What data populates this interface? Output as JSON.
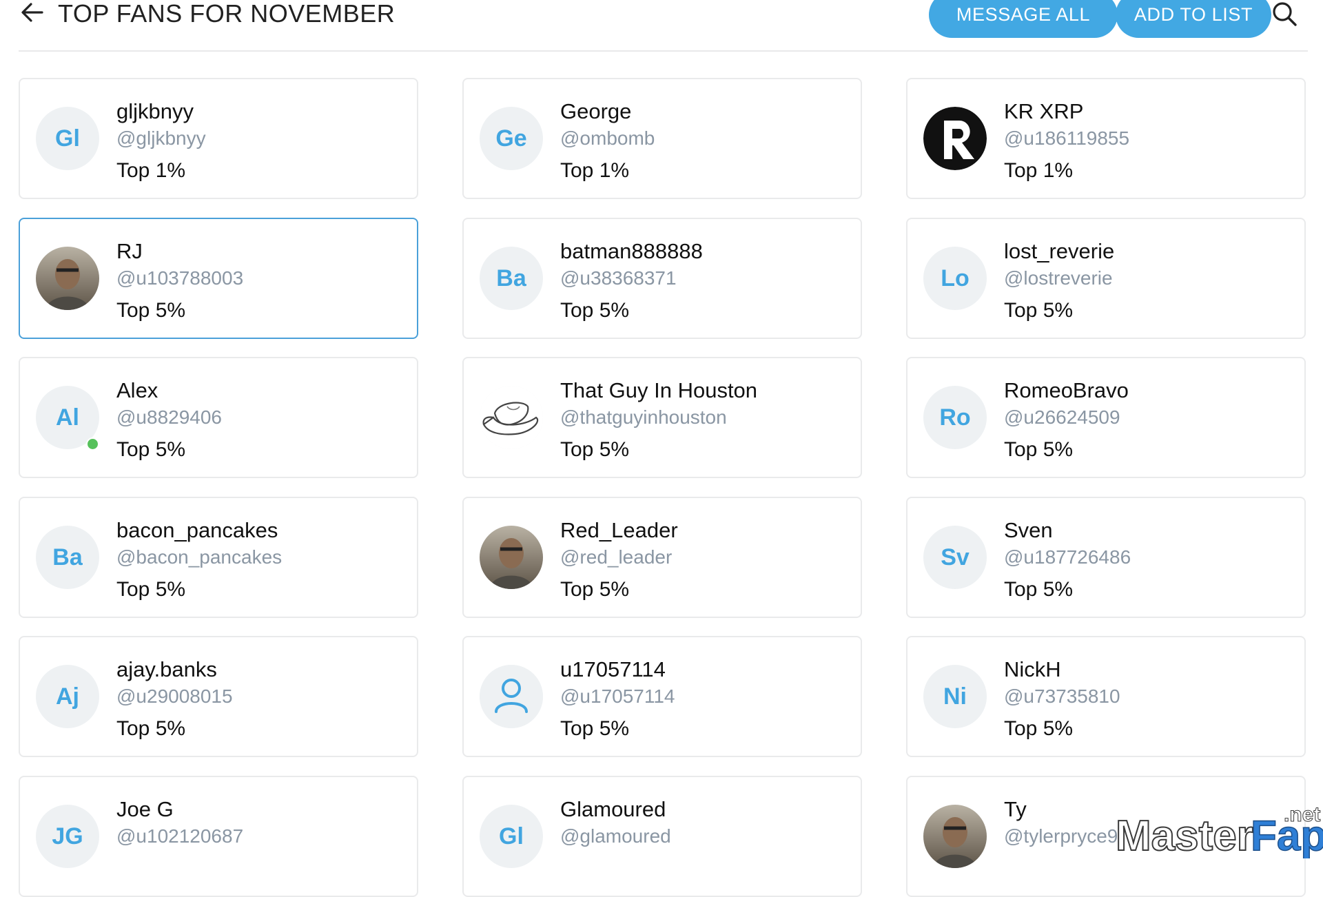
{
  "header": {
    "title": "TOP FANS FOR NOVEMBER",
    "message_all_label": "MESSAGE ALL",
    "add_to_list_label": "ADD TO LIST"
  },
  "colors": {
    "accent": "#42a8e3",
    "initials": "#41a5e0",
    "avatar_bg": "#eef1f3",
    "handle": "#8a96a3",
    "online": "#56c15b",
    "selected_border": "#4aa0d9"
  },
  "fans": [
    {
      "name": "gljkbnyy",
      "handle": "@gljkbnyy",
      "rank": "Top 1%",
      "initials": "Gl",
      "avatar": "initials"
    },
    {
      "name": "George",
      "handle": "@ombomb",
      "rank": "Top 1%",
      "initials": "Ge",
      "avatar": "initials"
    },
    {
      "name": "KR XRP",
      "handle": "@u186119855",
      "rank": "Top 1%",
      "initials": "",
      "avatar": "r-logo-icon"
    },
    {
      "name": "RJ",
      "handle": "@u103788003",
      "rank": "Top 5%",
      "initials": "",
      "avatar": "photo",
      "selected": true
    },
    {
      "name": "batman888888",
      "handle": "@u38368371",
      "rank": "Top 5%",
      "initials": "Ba",
      "avatar": "initials"
    },
    {
      "name": "lost_reverie",
      "handle": "@lostreverie",
      "rank": "Top 5%",
      "initials": "Lo",
      "avatar": "initials"
    },
    {
      "name": "Alex",
      "handle": "@u8829406",
      "rank": "Top 5%",
      "initials": "Al",
      "avatar": "initials",
      "online": true
    },
    {
      "name": "That Guy In Houston",
      "handle": "@thatguyinhouston",
      "rank": "Top 5%",
      "initials": "",
      "avatar": "cowboy-hat-icon"
    },
    {
      "name": "RomeoBravo",
      "handle": "@u26624509",
      "rank": "Top 5%",
      "initials": "Ro",
      "avatar": "initials"
    },
    {
      "name": "bacon_pancakes",
      "handle": "@bacon_pancakes",
      "rank": "Top 5%",
      "initials": "Ba",
      "avatar": "initials"
    },
    {
      "name": "Red_Leader",
      "handle": "@red_leader",
      "rank": "Top 5%",
      "initials": "",
      "avatar": "photo"
    },
    {
      "name": "Sven",
      "handle": "@u187726486",
      "rank": "Top 5%",
      "initials": "Sv",
      "avatar": "initials"
    },
    {
      "name": "ajay.banks",
      "handle": "@u29008015",
      "rank": "Top 5%",
      "initials": "Aj",
      "avatar": "initials"
    },
    {
      "name": "u17057114",
      "handle": "@u17057114",
      "rank": "Top 5%",
      "initials": "",
      "avatar": "user-icon"
    },
    {
      "name": "NickH",
      "handle": "@u73735810",
      "rank": "Top 5%",
      "initials": "Ni",
      "avatar": "initials"
    },
    {
      "name": "Joe G",
      "handle": "@u102120687",
      "rank": "",
      "initials": "JG",
      "avatar": "initials"
    },
    {
      "name": "Glamoured",
      "handle": "@glamoured",
      "rank": "",
      "initials": "Gl",
      "avatar": "initials"
    },
    {
      "name": "Ty",
      "handle": "@tylerpryce9",
      "rank": "",
      "initials": "",
      "avatar": "photo"
    }
  ],
  "watermark": {
    "text": "MasterFap",
    "suffix": ".net"
  }
}
